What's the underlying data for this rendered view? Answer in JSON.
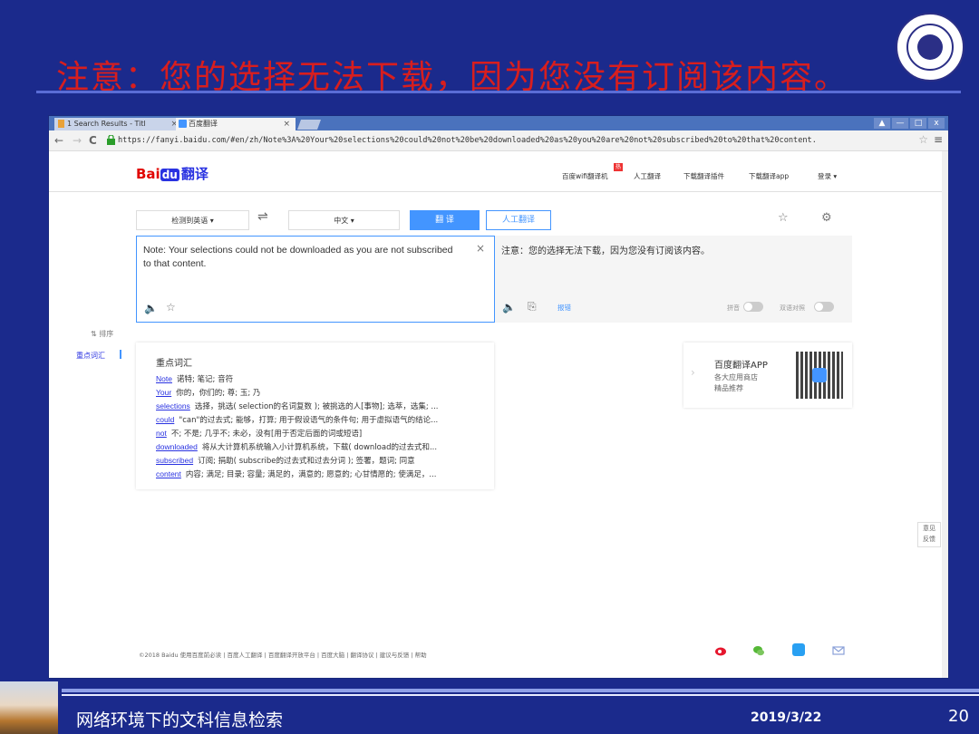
{
  "slide": {
    "title": "注意：您的选择无法下载，因为您没有订阅该内容。",
    "footer_title": "网络环境下的文科信息检索",
    "date": "2019/3/22",
    "page_number": "20"
  },
  "browser": {
    "tabs": [
      {
        "label": "1 Search Results - Titl",
        "close": "×"
      },
      {
        "label": "百度翻译",
        "close": "×"
      }
    ],
    "window_buttons": [
      "▲",
      "—",
      "□",
      "x"
    ],
    "url": "https://fanyi.baidu.com/#en/zh/Note%3A%20Your%20selections%20could%20not%20be%20downloaded%20as%20you%20are%20not%20subscribed%20to%20that%20content."
  },
  "header": {
    "logo_a": "Bai",
    "logo_b": "du",
    "logo_c": "翻译",
    "nav": [
      "百度wifi翻译机",
      "人工翻译",
      "下载翻译插件",
      "下载翻译app",
      "登录 ▾"
    ],
    "hot_badge": "热"
  },
  "toolbar": {
    "source_lang": "检测到英语 ▾",
    "swap": "⇌",
    "target_lang": "中文 ▾",
    "translate_button": "翻 译",
    "human_button": "人工翻译"
  },
  "source": {
    "text": "Note: Your selections could not be downloaded as you are not subscribed to that content.",
    "clear": "×"
  },
  "target": {
    "text": "注意：您的选择无法下载，因为您没有订阅该内容。",
    "report": "报错",
    "pinyin_label": "拼音",
    "bilingual_label": "双语对照"
  },
  "sidebar": {
    "sort_label": "⇅ 排序",
    "active_item": "重点词汇"
  },
  "vocab": {
    "title": "重点词汇",
    "rows": [
      {
        "word": "Note",
        "def": "诺特; 笔记; 音符"
      },
      {
        "word": "Your",
        "def": "你的，你们的; 尊; 玉; 乃"
      },
      {
        "word": "selections",
        "def": "选择，挑选( selection的名词复数 ); 被挑选的人[事物]; 选萃，选集; ..."
      },
      {
        "word": "could",
        "def": "\"can\"的过去式; 能够，打算; 用于假设语气的条件句; 用于虚拟语气的结论..."
      },
      {
        "word": "not",
        "def": "不; 不是; 几乎不; 未必，没有[用于否定后面的词或短语]"
      },
      {
        "word": "downloaded",
        "def": "将从大计算机系统输入小计算机系统，下载( download的过去式和..."
      },
      {
        "word": "subscribed",
        "def": "订阅; 捐助( subscribe的过去式和过去分词 ); 签署，题词; 同意"
      },
      {
        "word": "content",
        "def": "内容; 满足; 目录; 容量; 满足的，满意的; 愿意的; 心甘情愿的; 使满足，..."
      }
    ]
  },
  "app_promo": {
    "title": "百度翻译APP",
    "line1": "各大应用商店",
    "line2": "精品推荐"
  },
  "feedback": {
    "line1": "意见",
    "line2": "反馈"
  },
  "footer": {
    "text": "©2018 Baidu 使用百度前必读 | 百度人工翻译 | 百度翻译开放平台 | 百度大脑 | 翻译协议 | 建议与反馈 | 帮助"
  },
  "colors": {
    "slide_bg": "#1b2a8c",
    "title_red": "#d81e1e",
    "baidu_blue": "#2932e1",
    "accent_blue": "#4395ff"
  }
}
